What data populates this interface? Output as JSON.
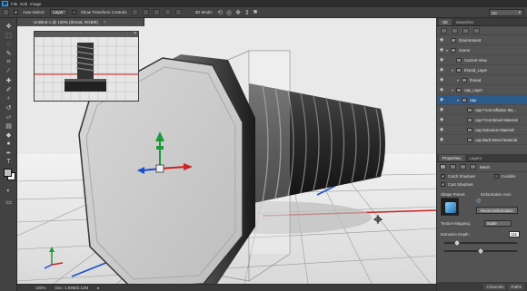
{
  "menubar": {
    "logo": "Ps",
    "items": [
      "File",
      "Edit",
      "Image"
    ]
  },
  "options": {
    "auto_select_label": "Auto-Select:",
    "auto_select_value": "Layer",
    "show_transform_label": "Show Transform Controls",
    "mode_label": "3D Mode:",
    "workspace": "3D"
  },
  "document": {
    "tab_title": "Untitled-1 @ 100% (thread, RGB/8)",
    "close": "×"
  },
  "status": {
    "zoom": "100%",
    "doc_size": "Doc: 1.59M/2.12M"
  },
  "layers_panel": {
    "tabs": [
      "3D",
      "Swatches"
    ],
    "rows": [
      {
        "label": "Environment",
        "indent": 0,
        "selected": false
      },
      {
        "label": "Scene",
        "indent": 0,
        "selected": false
      },
      {
        "label": "Current View",
        "indent": 1,
        "selected": false
      },
      {
        "label": "thread_Layer",
        "indent": 1,
        "selected": false
      },
      {
        "label": "thread",
        "indent": 2,
        "selected": false
      },
      {
        "label": "cap_Layer",
        "indent": 1,
        "selected": false
      },
      {
        "label": "cap",
        "indent": 2,
        "selected": true
      },
      {
        "label": "cap Front Inflation Ma...",
        "indent": 3,
        "selected": false
      },
      {
        "label": "cap Front Bevel Material",
        "indent": 3,
        "selected": false
      },
      {
        "label": "cap Extrusion Material",
        "indent": 3,
        "selected": false
      },
      {
        "label": "cap Back Bevel Material",
        "indent": 3,
        "selected": false
      }
    ]
  },
  "properties": {
    "tabs": [
      "Properties",
      "Layers"
    ],
    "type_label": "Mesh",
    "catch_shadows": "Catch Shadows",
    "invisible": "Invisible",
    "cast_shadows": "Cast Shadows",
    "shape_preset": "Shape Preset:",
    "deformation_axis": "Deformation Axis:",
    "reset_deformation": "Reset Deformation",
    "texture_mapping_label": "Texture Mapping:",
    "texture_mapping_value": "Scale",
    "extrusion_depth_label": "Extrusion Depth:",
    "extrusion_depth_value": "111"
  },
  "bottom_tabs": [
    "Channels",
    "Paths"
  ],
  "colors": {
    "ui_dark": "#424242",
    "panel": "#535353",
    "selection": "#2c5a8a",
    "canvas_bg": "#e9e9e9",
    "gizmo_green": "#1f9a3a",
    "gizmo_blue": "#1a4fd0",
    "gizmo_red": "#cc2222"
  },
  "icons": {
    "tools": [
      "move-tool-icon",
      "marquee-tool-icon",
      "lasso-tool-icon",
      "quick-select-icon",
      "crop-tool-icon",
      "eyedropper-icon",
      "healing-brush-icon",
      "brush-tool-icon",
      "clone-stamp-icon",
      "history-brush-icon",
      "eraser-icon",
      "gradient-tool-icon",
      "blur-tool-icon",
      "dodge-tool-icon",
      "pen-tool-icon",
      "type-tool-icon",
      "path-select-icon",
      "shape-tool-icon",
      "hand-tool-icon",
      "zoom-tool-icon"
    ]
  }
}
